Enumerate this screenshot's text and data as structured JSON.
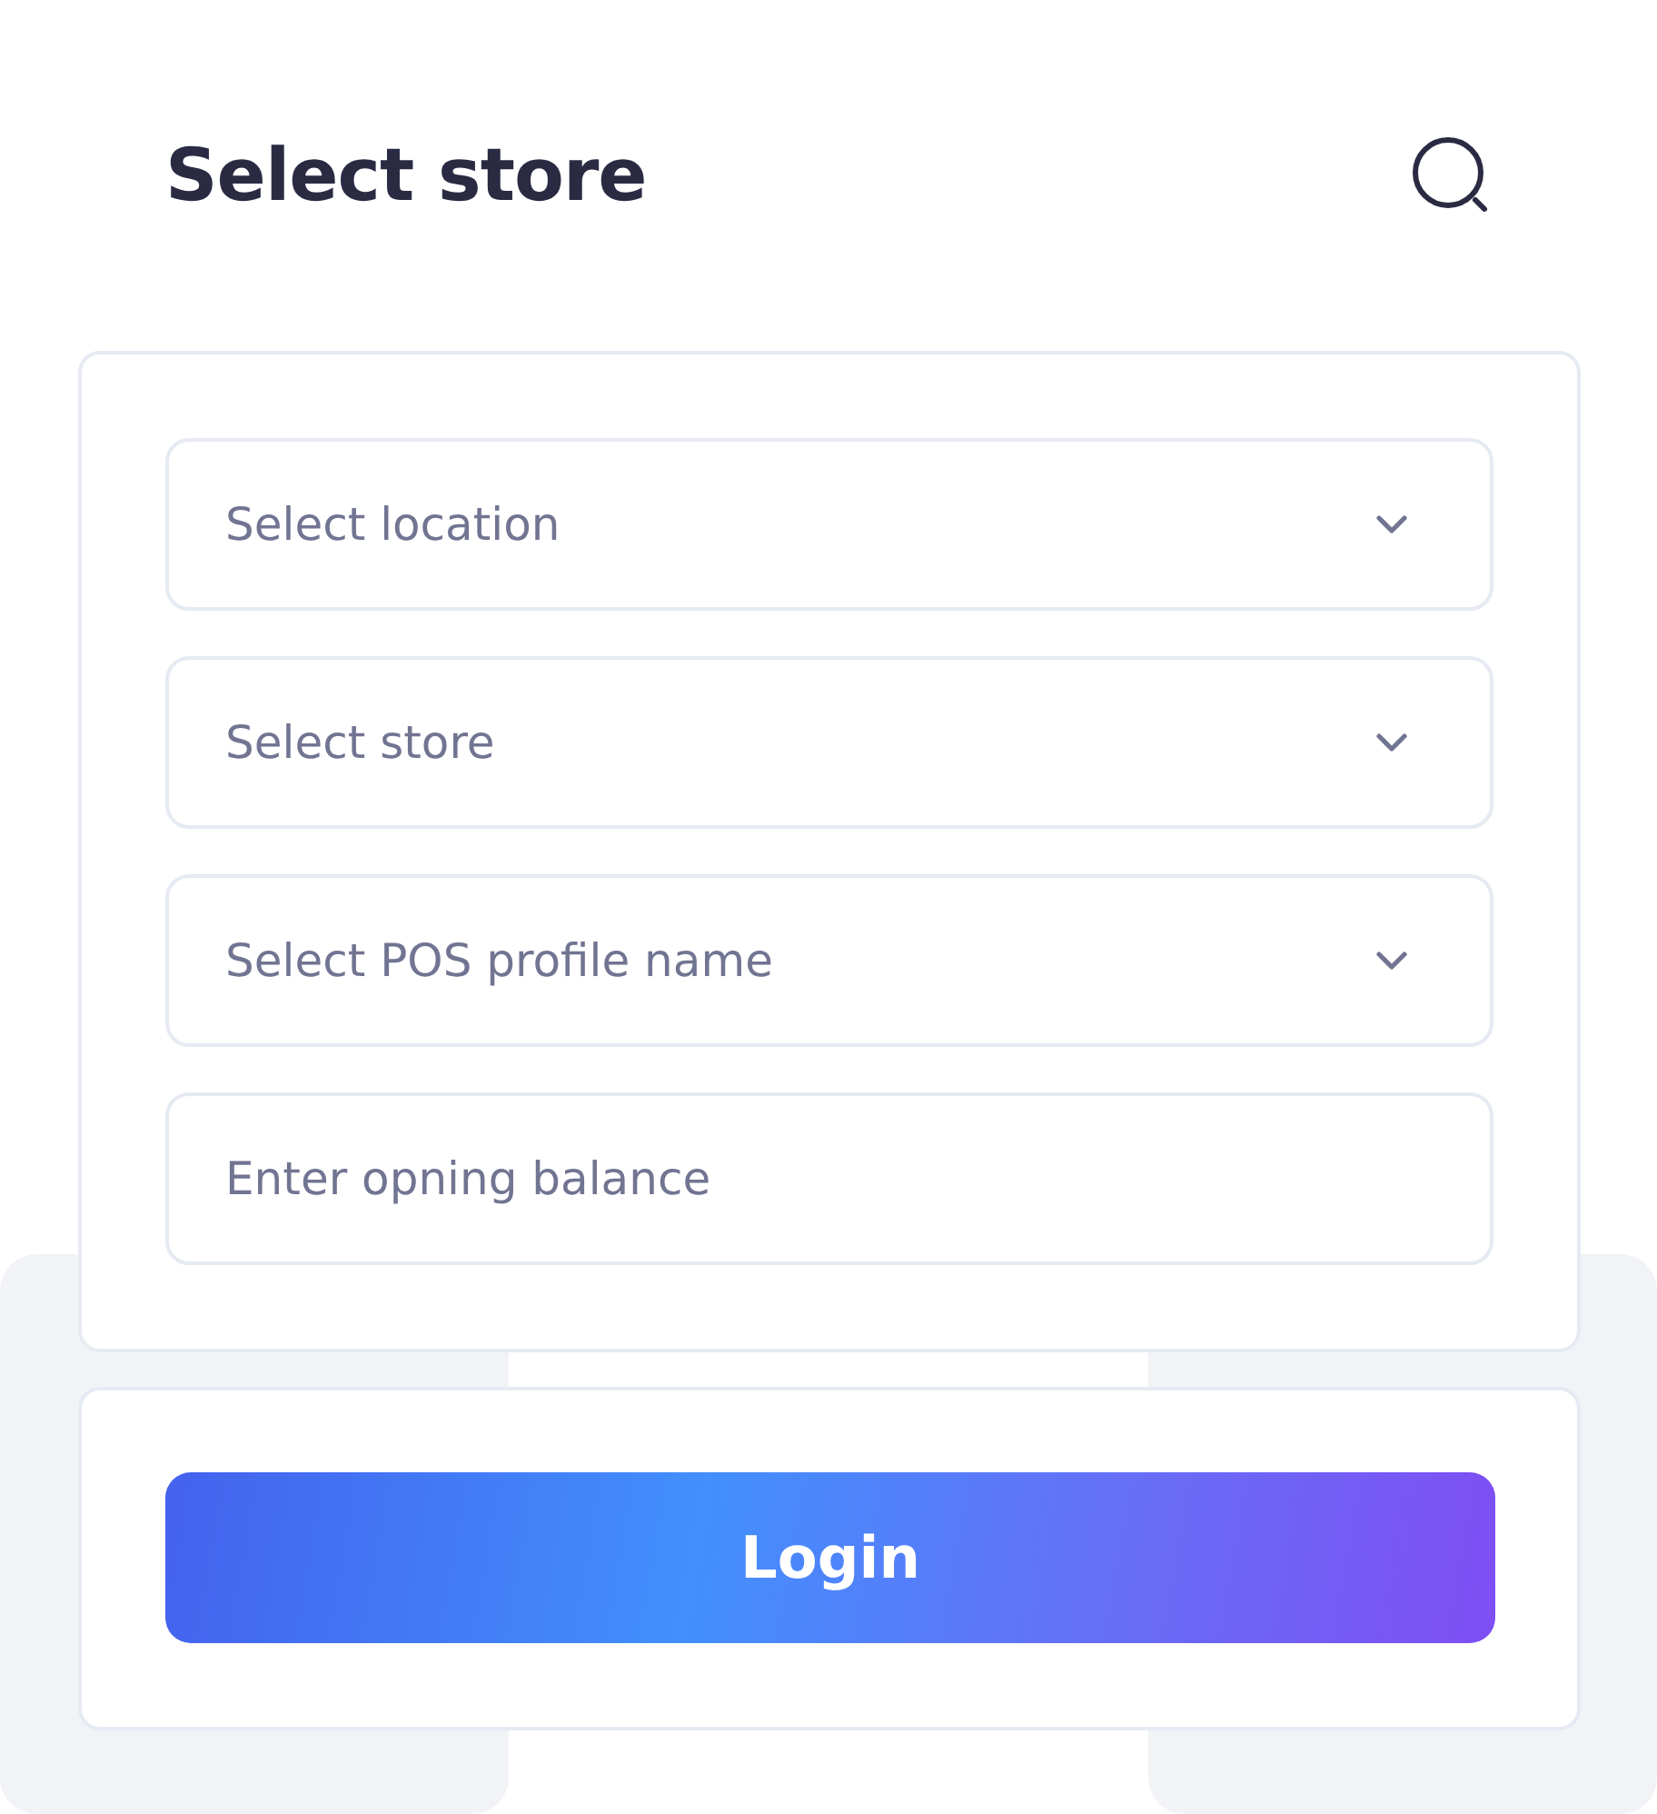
{
  "header": {
    "title": "Select store"
  },
  "form": {
    "fields": [
      {
        "kind": "select",
        "placeholder": "Select location"
      },
      {
        "kind": "select",
        "placeholder": "Select store"
      },
      {
        "kind": "select",
        "placeholder": "Select POS profile name"
      },
      {
        "kind": "input",
        "placeholder": "Enter opning balance"
      }
    ]
  },
  "login_button": {
    "label": "Login"
  }
}
